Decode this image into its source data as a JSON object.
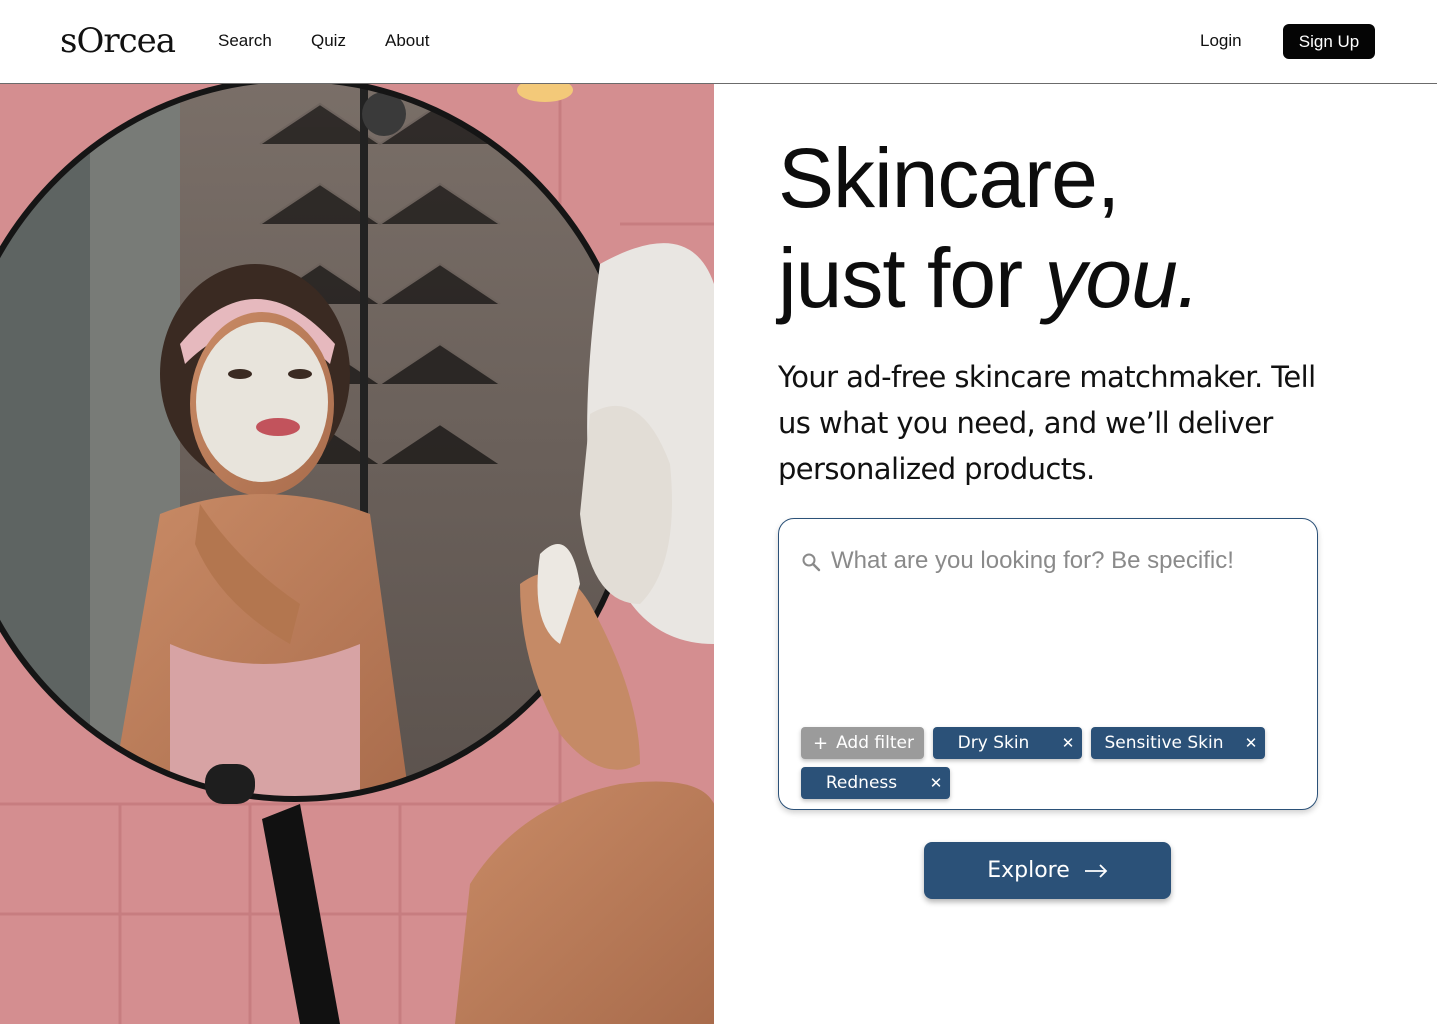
{
  "nav": {
    "logo": "sOrcea",
    "links": [
      "Search",
      "Quiz",
      "About"
    ],
    "login": "Login",
    "signup": "Sign Up"
  },
  "hero": {
    "headline_line1": "Skincare,",
    "headline_line2_prefix": "just for ",
    "headline_line2_italic": "you.",
    "subtext": "Your ad-free skincare matchmaker. Tell us what you need, and we’ll deliver personalized products."
  },
  "search": {
    "placeholder": "What are you looking for? Be specific!",
    "value": "",
    "add_filter": "Add filter",
    "filters": [
      "Dry Skin",
      "Sensitive Skin",
      "Redness"
    ]
  },
  "cta": {
    "explore": "Explore"
  },
  "colors": {
    "primary": "#2b5178",
    "signup_bg": "#050505",
    "add_filter_bg": "#9b9b9b",
    "tile_pink": "#d9898c"
  },
  "icons": [
    "search-icon",
    "plus-icon",
    "close-icon",
    "arrow-right-icon"
  ]
}
